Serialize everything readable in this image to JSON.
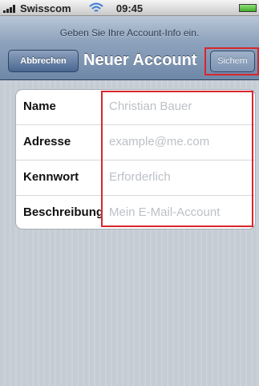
{
  "status_bar": {
    "carrier": "Swisscom",
    "time": "09:45",
    "icons": [
      "signal-icon",
      "wifi-icon",
      "battery-icon"
    ]
  },
  "nav": {
    "prompt": "Geben Sie Ihre Account-Info ein.",
    "title": "Neuer Account",
    "cancel_label": "Abbrechen",
    "save_label": "Sichern"
  },
  "form": {
    "rows": [
      {
        "label": "Name",
        "placeholder": "Christian Bauer"
      },
      {
        "label": "Adresse",
        "placeholder": "example@me.com"
      },
      {
        "label": "Kennwort",
        "placeholder": "Erforderlich"
      },
      {
        "label": "Beschreibung",
        "placeholder": "Mein E-Mail-Account"
      }
    ]
  },
  "colors": {
    "highlight": "#d8262e",
    "nav_bar": "#6f88a8",
    "background": "#c5ccd4"
  }
}
